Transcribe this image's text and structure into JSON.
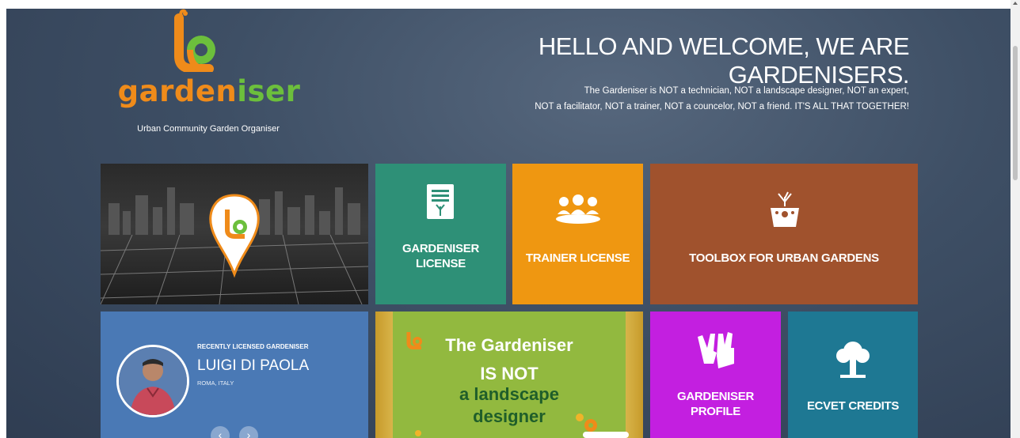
{
  "header": {
    "logo_text_a": "garden",
    "logo_text_b": "iser",
    "tagline": "Urban Community Garden Organiser",
    "title": "HELLO AND WELCOME, WE ARE GARDENISERS.",
    "intro_line1": "The Gardeniser is NOT a technician, NOT a landscape designer, NOT an expert,",
    "intro_line2": "NOT a facilitator, NOT a trainer, NOT a councelor, NOT a friend. IT'S ALL THAT TOGETHER!"
  },
  "tiles": {
    "gardeniser_license": "GARDENISER LICENSE",
    "trainer_license": "TRAINER LICENSE",
    "toolbox": "TOOLBOX FOR URBAN GARDENS",
    "gardeniser_profile": "GARDENISER PROFILE",
    "ecvet_credits": "ECVET CREDITS"
  },
  "recent": {
    "heading": "RECENTLY LICENSED GARDENISER",
    "name": "LUIGI DI PAOLA",
    "place": "ROMA, ITALY",
    "prev": "‹",
    "next": "›"
  },
  "poster": {
    "line1": "The Gardeniser",
    "line2": "IS NOT",
    "line3": "a landscape",
    "line4": "designer"
  },
  "colors": {
    "brand_orange": "#ef8b1a",
    "brand_green": "#6cbf3c",
    "license_teal": "#2e9077",
    "trainer_orange": "#ef9711",
    "toolbox_brown": "#a0522d",
    "profile_purple": "#c31fe0",
    "ecvet_blue": "#1e7893",
    "recent_blue": "#4a79b5"
  }
}
